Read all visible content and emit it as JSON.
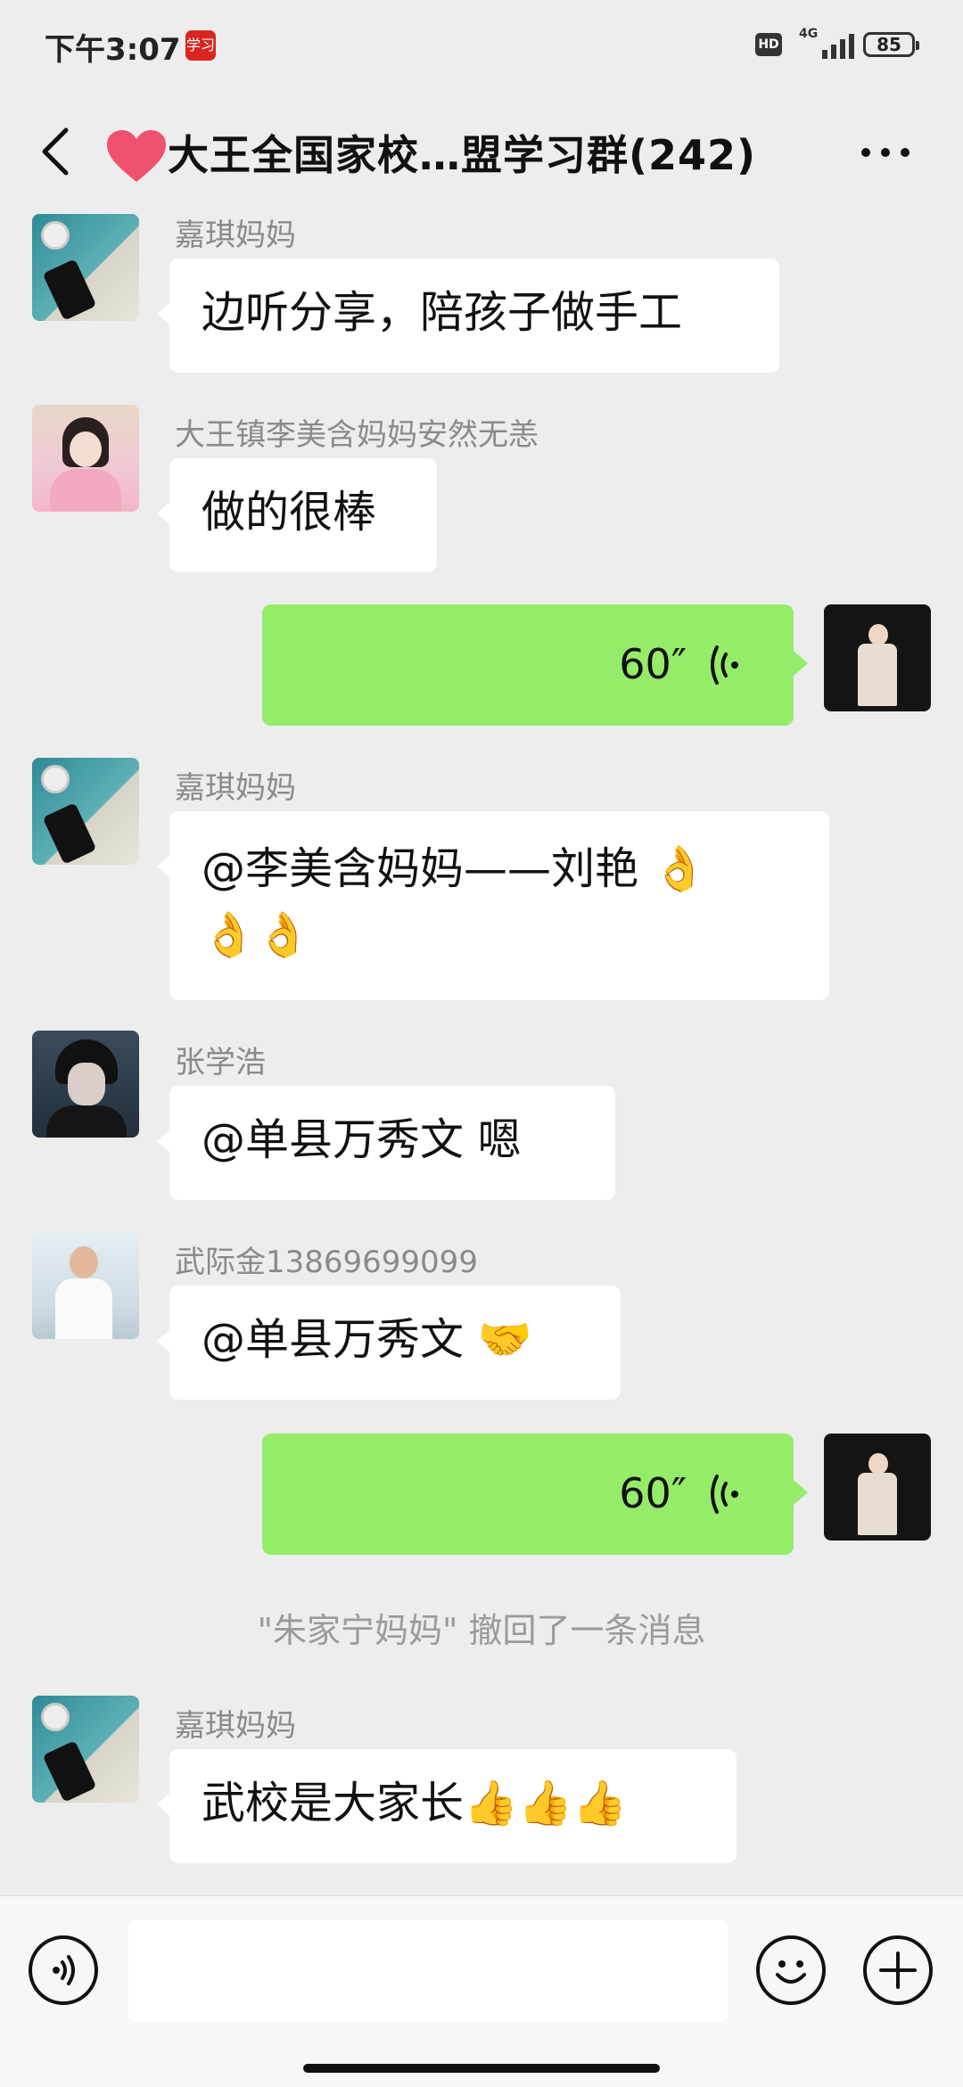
{
  "status_bar": {
    "time": "下午3:07",
    "app_badge": "学习",
    "hd": "HD",
    "network": "4G",
    "battery": "85"
  },
  "nav": {
    "title": "大王全国家校…盟学习群(242)"
  },
  "messages": [
    {
      "type": "text",
      "sender": "嘉琪妈妈",
      "text": "边听分享，陪孩子做手工"
    },
    {
      "type": "text",
      "sender": "大王镇李美含妈妈安然无恙",
      "text": "做的很棒"
    },
    {
      "type": "voice",
      "duration": "60″"
    },
    {
      "type": "text",
      "sender": "嘉琪妈妈",
      "text": "@李美含妈妈——刘艳 👌",
      "text2": "👌👌"
    },
    {
      "type": "text",
      "sender": "张学浩",
      "text": "@单县万秀文  嗯"
    },
    {
      "type": "text",
      "sender": "武际金13869699099",
      "text": "@单县万秀文 🤝"
    },
    {
      "type": "voice",
      "duration": "60″"
    },
    {
      "type": "system",
      "text": "\"朱家宁妈妈\" 撤回了一条消息"
    },
    {
      "type": "text",
      "sender": "嘉琪妈妈",
      "text": "武校是大家长👍👍👍"
    }
  ],
  "colors": {
    "background": "#ededed",
    "voice_bubble": "#95ec69",
    "incoming_bubble": "#ffffff"
  },
  "icons": [
    "back-icon",
    "heart-icon",
    "more-icon",
    "voice-wave-icon",
    "voice-input-icon",
    "emoji-icon",
    "plus-icon"
  ]
}
